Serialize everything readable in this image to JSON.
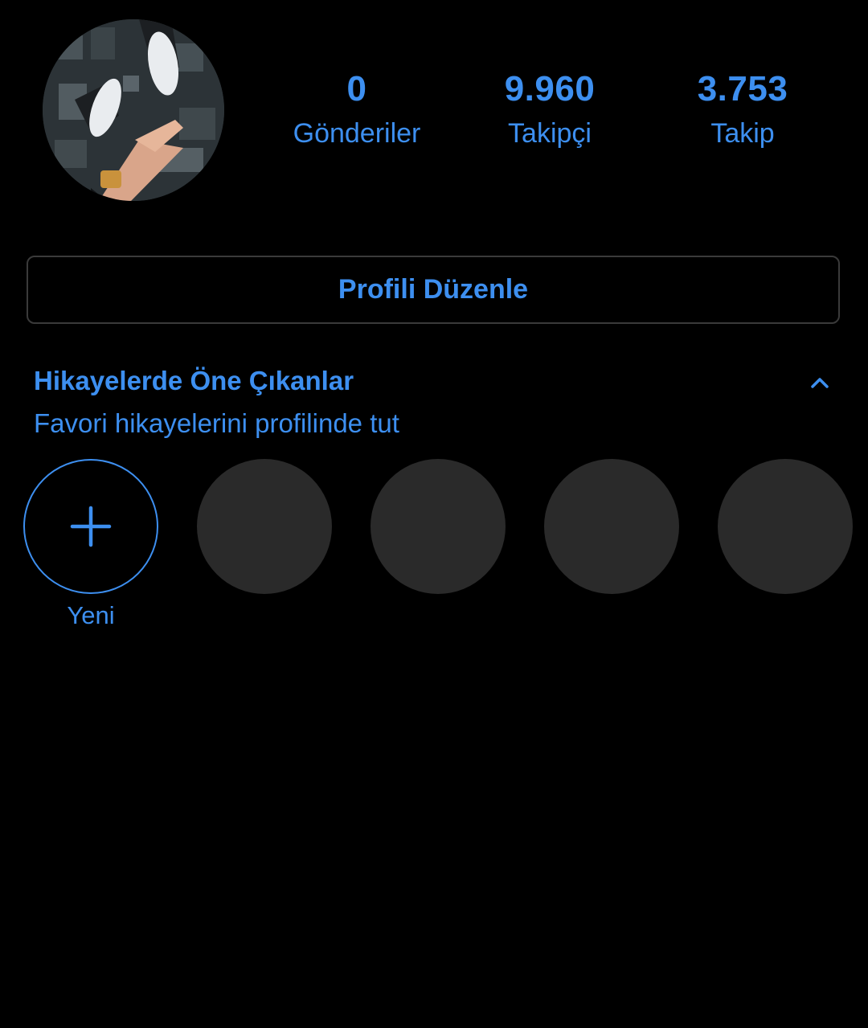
{
  "profile": {
    "avatar_icon": "profile-photo",
    "stats": [
      {
        "value": "0",
        "label": "Gönderiler"
      },
      {
        "value": "9.960",
        "label": "Takipçi"
      },
      {
        "value": "3.753",
        "label": "Takip"
      }
    ],
    "edit_button_label": "Profili Düzenle"
  },
  "highlights": {
    "title": "Hikayelerde Öne Çıkanlar",
    "subtitle": "Favori hikayelerini profilinde tut",
    "collapse_icon": "chevron-up-icon",
    "new_label": "Yeni",
    "new_icon": "plus-icon"
  },
  "colors": {
    "background": "#000000",
    "accent": "#3d8ff0",
    "placeholder": "#2a2a2a",
    "border": "#3a3a3a"
  }
}
